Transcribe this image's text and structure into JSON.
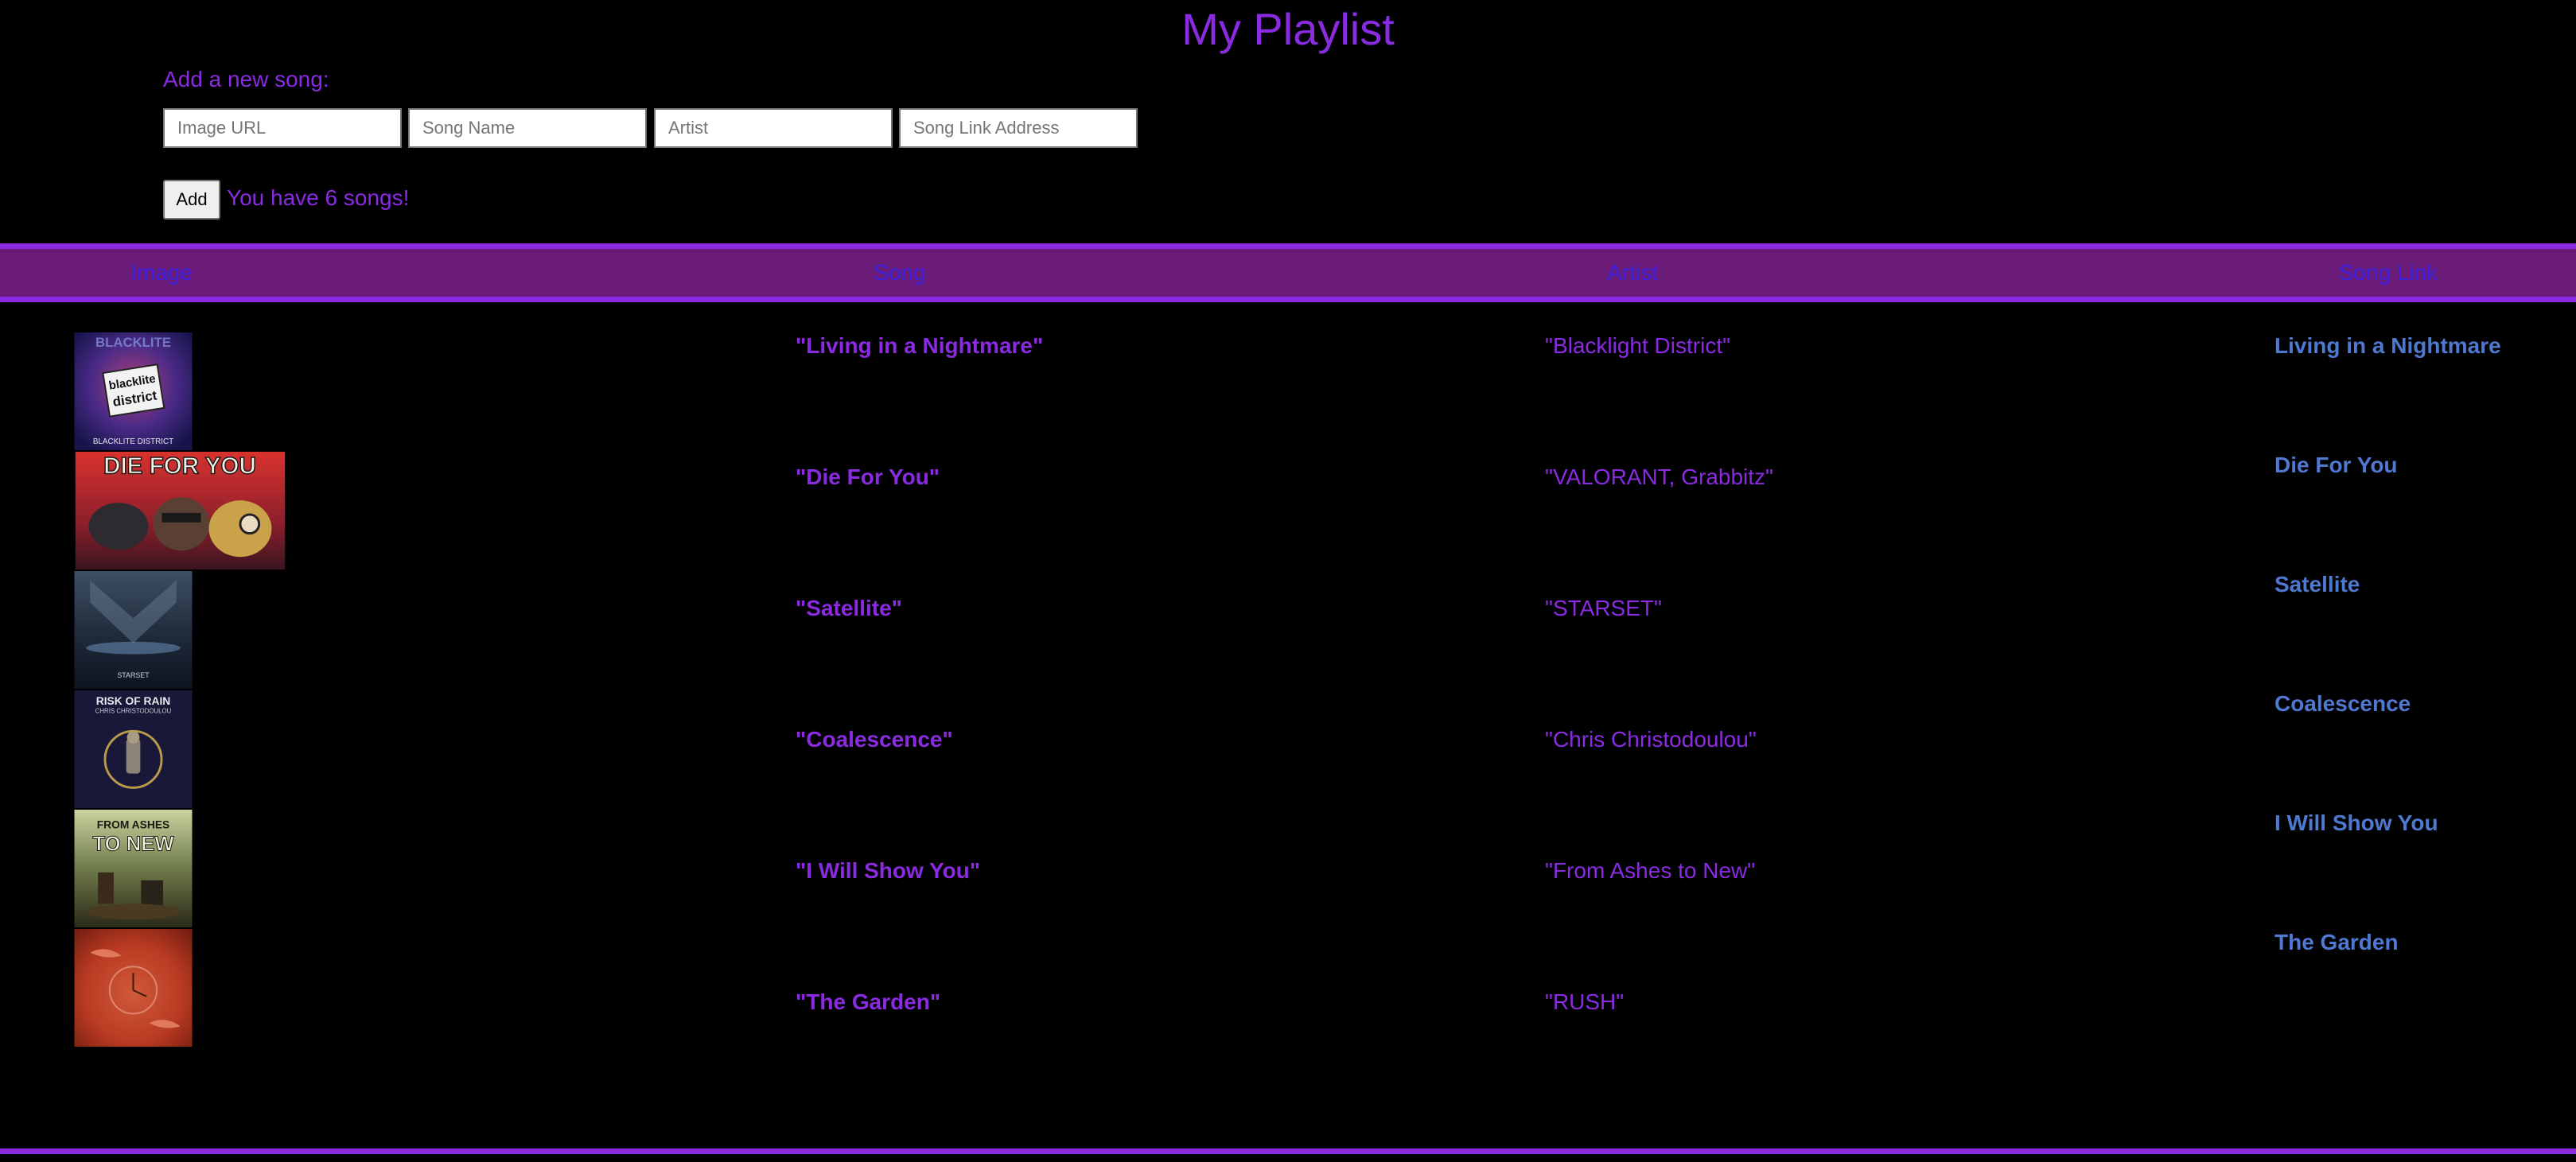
{
  "title": "My Playlist",
  "form": {
    "label": "Add a new song:",
    "fields": {
      "image_url": "Image URL",
      "song_name": "Song Name",
      "artist": "Artist",
      "link": "Song Link Address"
    },
    "add_label": "Add",
    "count_text": "You have 6 songs!"
  },
  "table": {
    "headers": [
      "Image",
      "Song",
      "Artist",
      "Song Link"
    ],
    "rows": [
      {
        "song": "\"Living in a Nightmare\"",
        "artist": "\"Blacklight District\"",
        "link": "Living in a Nightmare",
        "cover": "blacklite-district-cover"
      },
      {
        "song": "\"Die For You\"",
        "artist": "\"VALORANT, Grabbitz\"",
        "link": "Die For You",
        "cover": "die-for-you-cover"
      },
      {
        "song": "\"Satellite\"",
        "artist": "\"STARSET\"",
        "link": "Satellite",
        "cover": "starset-cover"
      },
      {
        "song": "\"Coalescence\"",
        "artist": "\"Chris Christodoulou\"",
        "link": "Coalescence",
        "cover": "risk-of-rain-cover"
      },
      {
        "song": "\"I Will Show You\"",
        "artist": "\"From Ashes to New\"",
        "link": "I Will Show You",
        "cover": "from-ashes-to-new-cover"
      },
      {
        "song": "\"The Garden\"",
        "artist": "\"RUSH\"",
        "link": "The Garden",
        "cover": "rush-cover"
      }
    ]
  },
  "covers": {
    "row1": {
      "top_text": "BLACKLITE",
      "sign_line1": "blacklite",
      "sign_line2": "district",
      "bottom_text": "BLACKLITE DISTRICT"
    },
    "row2": {
      "title_text": "DIE FOR YOU"
    },
    "row3": {
      "bottom_text": "STARSET"
    },
    "row4": {
      "title_text": "RISK OF RAIN",
      "subtitle_text": "CHRIS CHRISTODOULOU"
    },
    "row5": {
      "band_text": "FROM ASHES",
      "album_text": "TO NEW"
    }
  },
  "colors": {
    "background": "#000000",
    "accent": "#8a2be2",
    "header_fill": "#6a1b78",
    "header_text": "#3b1fdc",
    "link": "#4f78d0"
  }
}
